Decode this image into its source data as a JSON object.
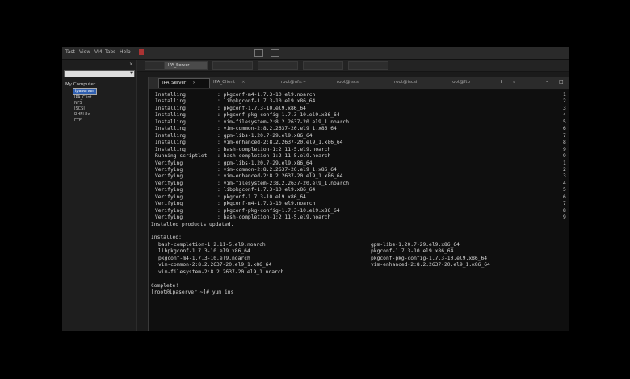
{
  "menubar": {
    "items": [
      "Tast",
      "View",
      "VM",
      "Tabs",
      "Help"
    ]
  },
  "toolstrip": {
    "tabs": [
      "IPA_Server",
      "",
      "",
      "",
      ""
    ]
  },
  "sidebar": {
    "close": "×",
    "search_placeholder": "",
    "root": "My Computer",
    "items": [
      "ipaserver",
      "IPA_Clint",
      "NFS",
      "ISCSI",
      "RHEL8x",
      "FTP"
    ]
  },
  "terminal_tabs": [
    {
      "label": "IPA_Server",
      "active": true
    },
    {
      "label": "IPA_Client",
      "active": false
    },
    {
      "label": "root@nfs:~",
      "active": false
    },
    {
      "label": "root@iscsi",
      "active": false
    },
    {
      "label": "root@iscsi",
      "active": false
    },
    {
      "label": "root@ftp",
      "active": false
    }
  ],
  "terminal": {
    "progress_lines": [
      {
        "action": "Installing",
        "pkg": ": pkgconf-m4-1.7.3-10.el9.noarch",
        "n": "1,"
      },
      {
        "action": "Installing",
        "pkg": ": libpkgconf-1.7.3-10.el9.x86_64",
        "n": "2,"
      },
      {
        "action": "Installing",
        "pkg": ": pkgconf-1.7.3-10.el9.x86_64",
        "n": "3,"
      },
      {
        "action": "Installing",
        "pkg": ": pkgconf-pkg-config-1.7.3-10.el9.x86_64",
        "n": "4,"
      },
      {
        "action": "Installing",
        "pkg": ": vim-filesystem-2:8.2.2637-20.el9_1.noarch",
        "n": "5,"
      },
      {
        "action": "Installing",
        "pkg": ": vim-common-2:8.2.2637-20.el9_1.x86_64",
        "n": "6,"
      },
      {
        "action": "Installing",
        "pkg": ": gpm-libs-1.20.7-29.el9.x86_64",
        "n": "7,"
      },
      {
        "action": "Installing",
        "pkg": ": vim-enhanced-2:8.2.2637-20.el9_1.x86_64",
        "n": "8,"
      },
      {
        "action": "Installing",
        "pkg": ": bash-completion-1:2.11-5.el9.noarch",
        "n": "9,"
      },
      {
        "action": "Running scriptlet",
        "pkg": ": bash-completion-1:2.11-5.el9.noarch",
        "n": "9,"
      },
      {
        "action": "Verifying",
        "pkg": ": gpm-libs-1.20.7-29.el9.x86_64",
        "n": "1,"
      },
      {
        "action": "Verifying",
        "pkg": ": vim-common-2:8.2.2637-20.el9_1.x86_64",
        "n": "2,"
      },
      {
        "action": "Verifying",
        "pkg": ": vim-enhanced-2:8.2.2637-20.el9_1.x86_64",
        "n": "3,"
      },
      {
        "action": "Verifying",
        "pkg": ": vim-filesystem-2:8.2.2637-20.el9_1.noarch",
        "n": "4,"
      },
      {
        "action": "Verifying",
        "pkg": ": libpkgconf-1.7.3-10.el9.x86_64",
        "n": "5,"
      },
      {
        "action": "Verifying",
        "pkg": ": pkgconf-1.7.3-10.el9.x86_64",
        "n": "6,"
      },
      {
        "action": "Verifying",
        "pkg": ": pkgconf-m4-1.7.3-10.el9.noarch",
        "n": "7,"
      },
      {
        "action": "Verifying",
        "pkg": ": pkgconf-pkg-config-1.7.3-10.el9.x86_64",
        "n": "8,"
      },
      {
        "action": "Verifying",
        "pkg": ": bash-completion-1:2.11-5.el9.noarch",
        "n": "9,"
      }
    ],
    "installed_products_updated": "Installed products updated.",
    "installed_header": "Installed:",
    "installed_left": [
      "bash-completion-1:2.11-5.el9.noarch",
      "libpkgconf-1.7.3-10.el9.x86_64",
      "pkgconf-m4-1.7.3-10.el9.noarch",
      "vim-common-2:8.2.2637-20.el9_1.x86_64",
      "vim-filesystem-2:8.2.2637-20.el9_1.noarch"
    ],
    "installed_right": [
      "gpm-libs-1.20.7-29.el9.x86_64",
      "pkgconf-1.7.3-10.el9.x86_64",
      "pkgconf-pkg-config-1.7.3-10.el9.x86_64",
      "vim-enhanced-2:8.2.2637-20.el9_1.x86_64"
    ],
    "complete": "Complete!",
    "prompt": "[root@ipaserver ~]# yum ins"
  }
}
